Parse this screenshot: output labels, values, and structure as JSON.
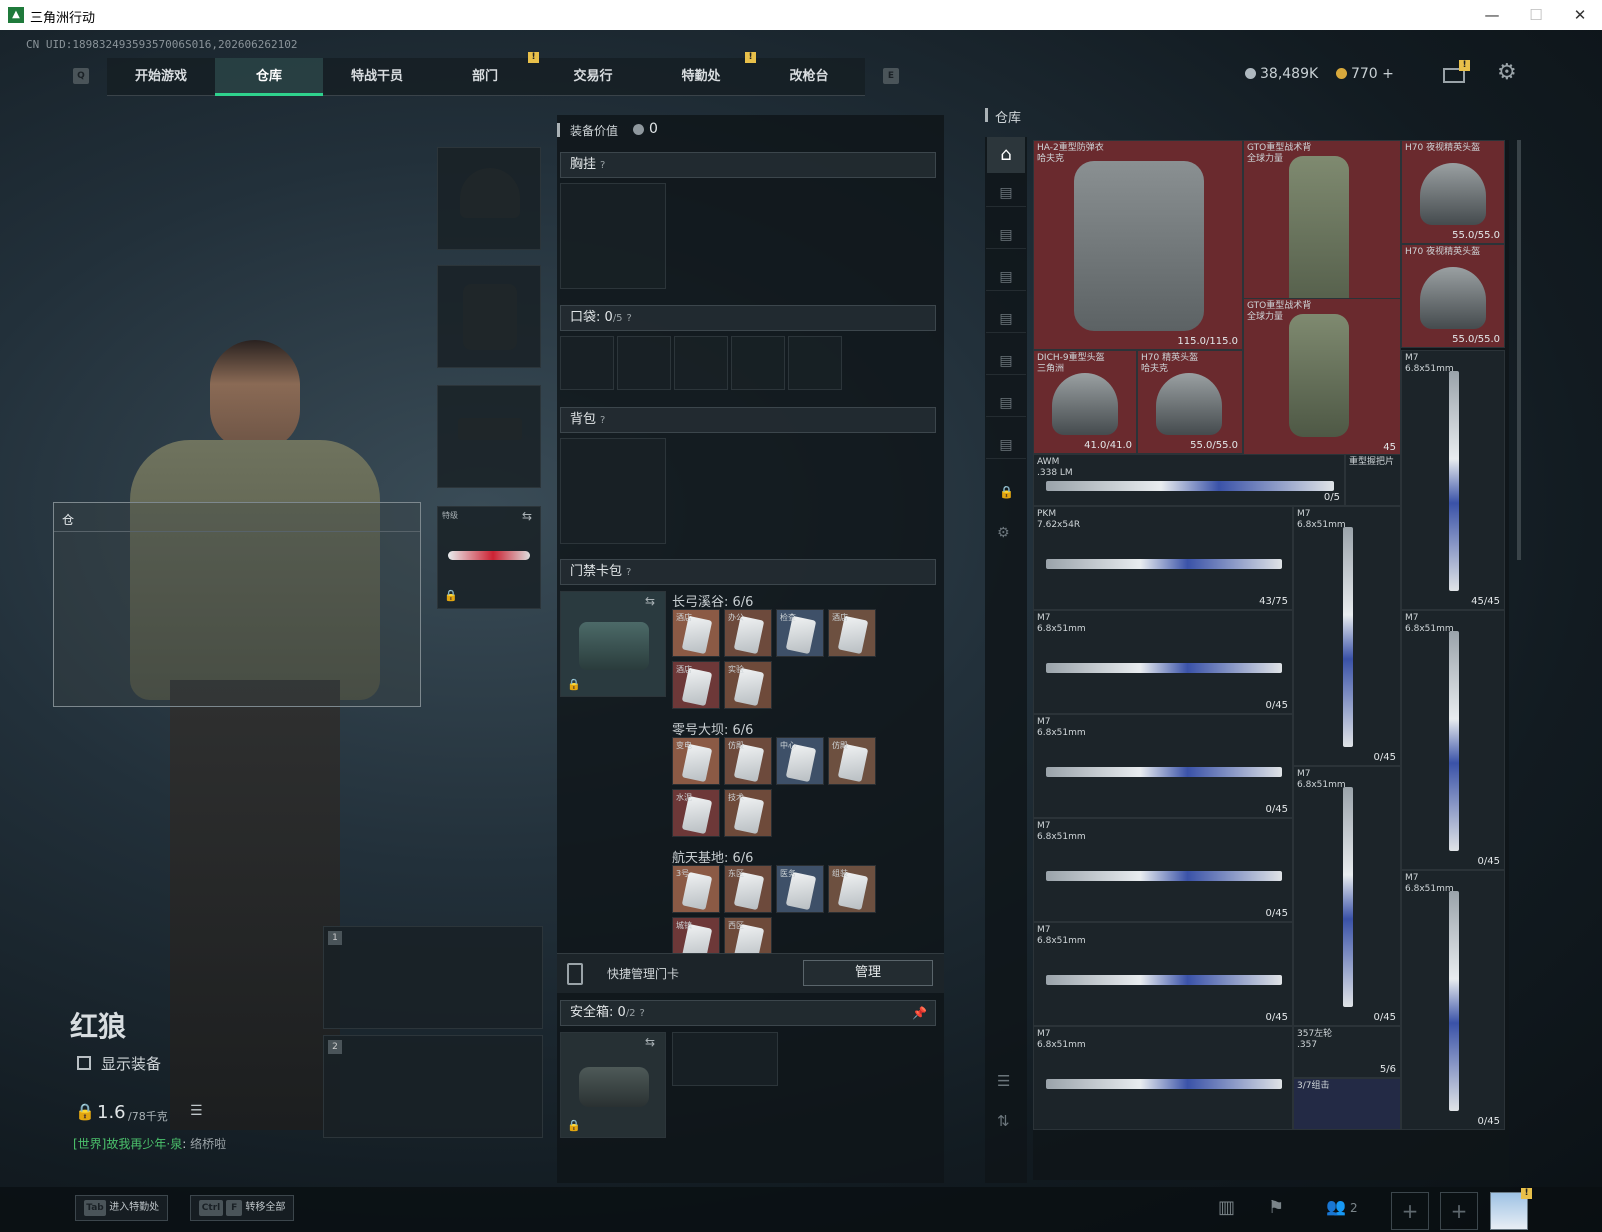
{
  "window": {
    "title": "三角洲行动",
    "min": "—",
    "max": "☐",
    "close": "✕"
  },
  "header": {
    "uid": "CN UID:18983249359357006S016,202606262102",
    "key_left": "Q",
    "key_right": "E",
    "tabs": [
      {
        "label": "开始游戏"
      },
      {
        "label": "仓库",
        "active": true
      },
      {
        "label": "特战干员"
      },
      {
        "label": "部门"
      },
      {
        "label": "交易行"
      },
      {
        "label": "特勤处"
      },
      {
        "label": "改枪台"
      }
    ],
    "notif": "!",
    "silver": "38,489K",
    "gold": "770",
    "plus": "+"
  },
  "character": {
    "name": "红狼",
    "show_gear": "显示装备",
    "weight": "1.6",
    "weight_max": "/78千克",
    "tooltip_title": "仓",
    "chat_channel": "[世界]",
    "chat_msg": "故我再少年·泉",
    "chat_tail": "络桥啦",
    "melee_label": "特级",
    "slot1": "1",
    "slot2": "2"
  },
  "gear": {
    "value_label": "装备价值",
    "value": "0",
    "chest": "胸挂",
    "pockets": "口袋:",
    "pockets_val": "0",
    "pockets_max": "/5",
    "backpack": "背包",
    "keycard": "门禁卡包",
    "q": "?",
    "map1": "长弓溪谷: 6/6",
    "map2": "零号大坝: 6/6",
    "map3": "航天基地: 6/6",
    "cards1": [
      "酒店",
      "办公",
      "检查",
      "酒店",
      "酒店",
      "实验"
    ],
    "cards2": [
      "变电",
      "仿殿",
      "中心",
      "仿殿",
      "水泥",
      "技术"
    ],
    "cards3": [
      "3号",
      "东区",
      "医务",
      "组装",
      "城镇",
      "西区"
    ],
    "quick_manage": "快捷管理门卡",
    "manage_btn": "管理",
    "safebox": "安全箱:",
    "safebox_val": "0",
    "safebox_max": "/2"
  },
  "stash": {
    "title": "仓库",
    "items": [
      {
        "name": "HA-2重型防弹衣\n哈夫克",
        "count": "115.0/115.0"
      },
      {
        "name": "GTO重型战术背\n全球力量",
        "count": "45"
      },
      {
        "name": "H70 夜视精英头盔",
        "count": "55.0/55.0"
      },
      {
        "name": "H70 夜视精英头盔",
        "count": "55.0/55.0"
      },
      {
        "name": "GTO重型战术背\n全球力量",
        "count": "45"
      },
      {
        "name": "DICH-9重型头盔\n三角洲",
        "count": "41.0/41.0"
      },
      {
        "name": "H70 精英头盔\n哈夫克",
        "count": "55.0/55.0"
      },
      {
        "name": "M7\n6.8x51mm",
        "count": "45/45"
      },
      {
        "name": "AWM\n.338 LM",
        "count": "0/5"
      },
      {
        "name": "重型握把片",
        "count": ""
      },
      {
        "name": "PKM\n7.62x54R",
        "count": "43/75"
      },
      {
        "name": "M7\n6.8x51mm",
        "count": "0/45"
      },
      {
        "name": "M7\n6.8x51mm",
        "count": "0/45"
      },
      {
        "name": "M7\n6.8x51mm",
        "count": "0/45"
      },
      {
        "name": "M7\n6.8x51mm",
        "count": "0/45"
      },
      {
        "name": "M7\n6.8x51mm",
        "count": "0/45"
      },
      {
        "name": "M7\n6.8x51mm",
        "count": "0/45"
      },
      {
        "name": "M7\n6.8x51mm",
        "count": "0/45"
      },
      {
        "name": "M7\n6.8x51mm",
        "count": "0/45"
      },
      {
        "name": "M7\n6.8x51mm",
        "count": "0/45"
      },
      {
        "name": "M7\n6.8x51mm",
        "count": ""
      },
      {
        "name": "357左轮\n.357",
        "count": "5/6"
      },
      {
        "name": "3/7组击",
        "count": ""
      }
    ]
  },
  "bottom": {
    "key_tab": "Tab",
    "enter_ops": "进入特勤处",
    "key_ctrl": "Ctrl",
    "key_f": "F",
    "transfer_all": "转移全部",
    "squad_count": "2"
  }
}
